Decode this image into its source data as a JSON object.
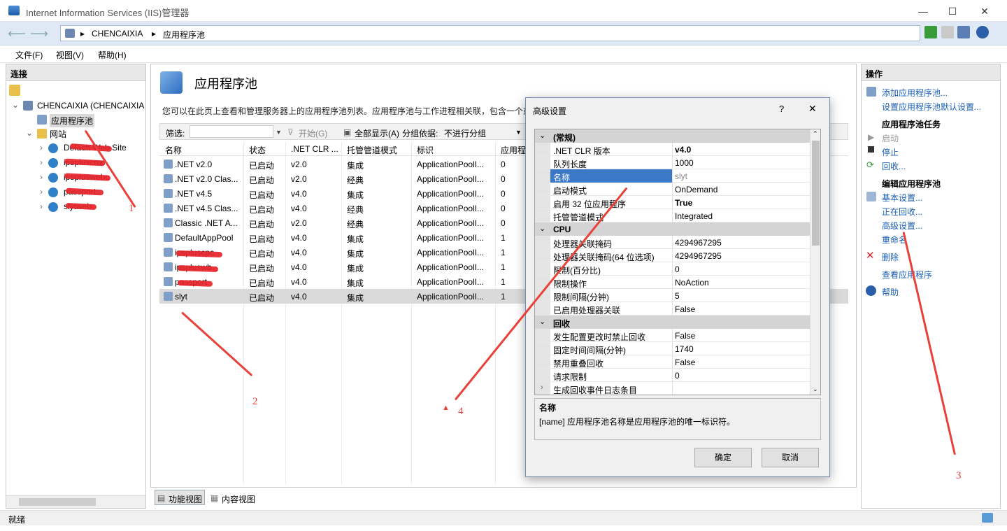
{
  "window": {
    "title": "Internet Information Services (IIS)管理器",
    "controls": [
      "—",
      "☐",
      "✕"
    ]
  },
  "nav": {
    "breadcrumb": [
      "CHENCAIXIA",
      "应用程序池"
    ]
  },
  "menu": [
    "文件(F)",
    "视图(V)",
    "帮助(H)"
  ],
  "left": {
    "header": "连接",
    "server": "CHENCAIXIA (CHENCAIXIA",
    "app_pools": "应用程序池",
    "sites": "网站",
    "site_items": [
      "Default Web Site",
      "ipspluscmc",
      "ipspluswebc",
      "passport",
      "slytweb"
    ]
  },
  "center": {
    "title": "应用程序池",
    "description": "您可以在此页上查看和管理服务器上的应用程序池列表。应用程序池与工作进程相关联，包含一个或",
    "filter_label": "筛选:",
    "start_label": "开始(G)",
    "show_all": "全部显示(A)",
    "group_label": "分组依据:",
    "group_value": "不进行分组",
    "columns": [
      "名称",
      "状态",
      ".NET CLR ...",
      "托管管道模式",
      "标识",
      "应用程"
    ],
    "rows": [
      {
        "name": ".NET v2.0",
        "status": "已启动",
        "clr": "v2.0",
        "mode": "集成",
        "identity": "ApplicationPoolI...",
        "apps": "0"
      },
      {
        "name": ".NET v2.0 Clas...",
        "status": "已启动",
        "clr": "v2.0",
        "mode": "经典",
        "identity": "ApplicationPoolI...",
        "apps": "0"
      },
      {
        "name": ".NET v4.5",
        "status": "已启动",
        "clr": "v4.0",
        "mode": "集成",
        "identity": "ApplicationPoolI...",
        "apps": "0"
      },
      {
        "name": ".NET v4.5 Clas...",
        "status": "已启动",
        "clr": "v4.0",
        "mode": "经典",
        "identity": "ApplicationPoolI...",
        "apps": "0"
      },
      {
        "name": "Classic .NET A...",
        "status": "已启动",
        "clr": "v2.0",
        "mode": "经典",
        "identity": "ApplicationPoolI...",
        "apps": "0"
      },
      {
        "name": "DefaultAppPool",
        "status": "已启动",
        "clr": "v4.0",
        "mode": "集成",
        "identity": "ApplicationPoolI...",
        "apps": "1"
      },
      {
        "name": "ipspluscpc",
        "status": "已启动",
        "clr": "v4.0",
        "mode": "集成",
        "identity": "ApplicationPoolI...",
        "apps": "1"
      },
      {
        "name": "ipspluswb",
        "status": "已启动",
        "clr": "v4.0",
        "mode": "集成",
        "identity": "ApplicationPoolI...",
        "apps": "1"
      },
      {
        "name": "passport",
        "status": "已启动",
        "clr": "v4.0",
        "mode": "集成",
        "identity": "ApplicationPoolI...",
        "apps": "1"
      },
      {
        "name": "slyt",
        "status": "已启动",
        "clr": "v4.0",
        "mode": "集成",
        "identity": "ApplicationPoolI...",
        "apps": "1"
      }
    ],
    "tabs": [
      "功能视图",
      "内容视图"
    ]
  },
  "right": {
    "header": "操作",
    "add_pool": "添加应用程序池...",
    "set_defaults": "设置应用程序池默认设置...",
    "tasks_header": "应用程序池任务",
    "start": "启动",
    "stop": "停止",
    "recycle": "回收...",
    "edit_header": "编辑应用程序池",
    "basic": "基本设置...",
    "recycling": "正在回收...",
    "advanced": "高级设置...",
    "rename": "重命名",
    "delete": "删除",
    "view_apps": "查看应用程序",
    "help": "帮助"
  },
  "dialog": {
    "title": "高级设置",
    "question": "?",
    "close": "✕",
    "props": [
      {
        "type": "cat",
        "label": "(常规)"
      },
      {
        "type": "prop",
        "k": ".NET CLR 版本",
        "v": "v4.0",
        "bold": true
      },
      {
        "type": "prop",
        "k": "队列长度",
        "v": "1000"
      },
      {
        "type": "prop",
        "k": "名称",
        "v": "slyt",
        "sel": true
      },
      {
        "type": "prop",
        "k": "启动模式",
        "v": "OnDemand"
      },
      {
        "type": "prop",
        "k": "启用 32 位应用程序",
        "v": "True",
        "bold": true
      },
      {
        "type": "prop",
        "k": "托管管道模式",
        "v": "Integrated"
      },
      {
        "type": "cat",
        "label": "CPU"
      },
      {
        "type": "prop",
        "k": "处理器关联掩码",
        "v": "4294967295"
      },
      {
        "type": "prop",
        "k": "处理器关联掩码(64 位选项)",
        "v": "4294967295"
      },
      {
        "type": "prop",
        "k": "限制(百分比)",
        "v": "0"
      },
      {
        "type": "prop",
        "k": "限制操作",
        "v": "NoAction"
      },
      {
        "type": "prop",
        "k": "限制间隔(分钟)",
        "v": "5"
      },
      {
        "type": "prop",
        "k": "已启用处理器关联",
        "v": "False"
      },
      {
        "type": "cat",
        "label": "回收"
      },
      {
        "type": "prop",
        "k": "发生配置更改时禁止回收",
        "v": "False"
      },
      {
        "type": "prop",
        "k": "固定时间间隔(分钟)",
        "v": "1740"
      },
      {
        "type": "prop",
        "k": "禁用重叠回收",
        "v": "False"
      },
      {
        "type": "prop",
        "k": "请求限制",
        "v": "0"
      },
      {
        "type": "prop",
        "k": "生成回收事件日志条目",
        "v": "",
        "collapsed": true
      }
    ],
    "help_title": "名称",
    "help_text": "[name] 应用程序池名称是应用程序池的唯一标识符。",
    "ok": "确定",
    "cancel": "取消"
  },
  "status": "就绪",
  "annotations": [
    "1",
    "2",
    "3",
    "4"
  ]
}
